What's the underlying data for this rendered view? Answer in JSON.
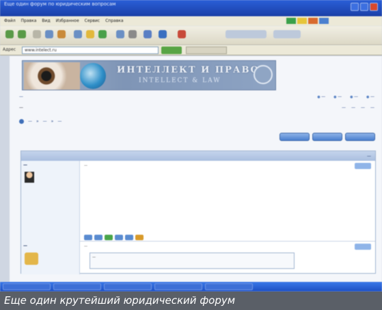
{
  "window": {
    "title_line1": "Еще один форум по юридическим вопросам",
    "title_line2": ""
  },
  "menu": {
    "items": [
      "Файл",
      "Правка",
      "Вид",
      "Избранное",
      "Сервис",
      "Справка"
    ]
  },
  "address": {
    "label": "Адрес",
    "value": "www.intelect.ru"
  },
  "banner": {
    "title": "ИНТЕЛЛЕКТ И ПРАВО",
    "subtitle": "INTELLECT & LAW"
  },
  "caption": {
    "text": "Еще один крутейший юридический форум"
  },
  "colors": {
    "caption_bg": "#5a5f67",
    "titlebar": "#2a5fd8",
    "accent_blue": "#4a7fcf"
  }
}
